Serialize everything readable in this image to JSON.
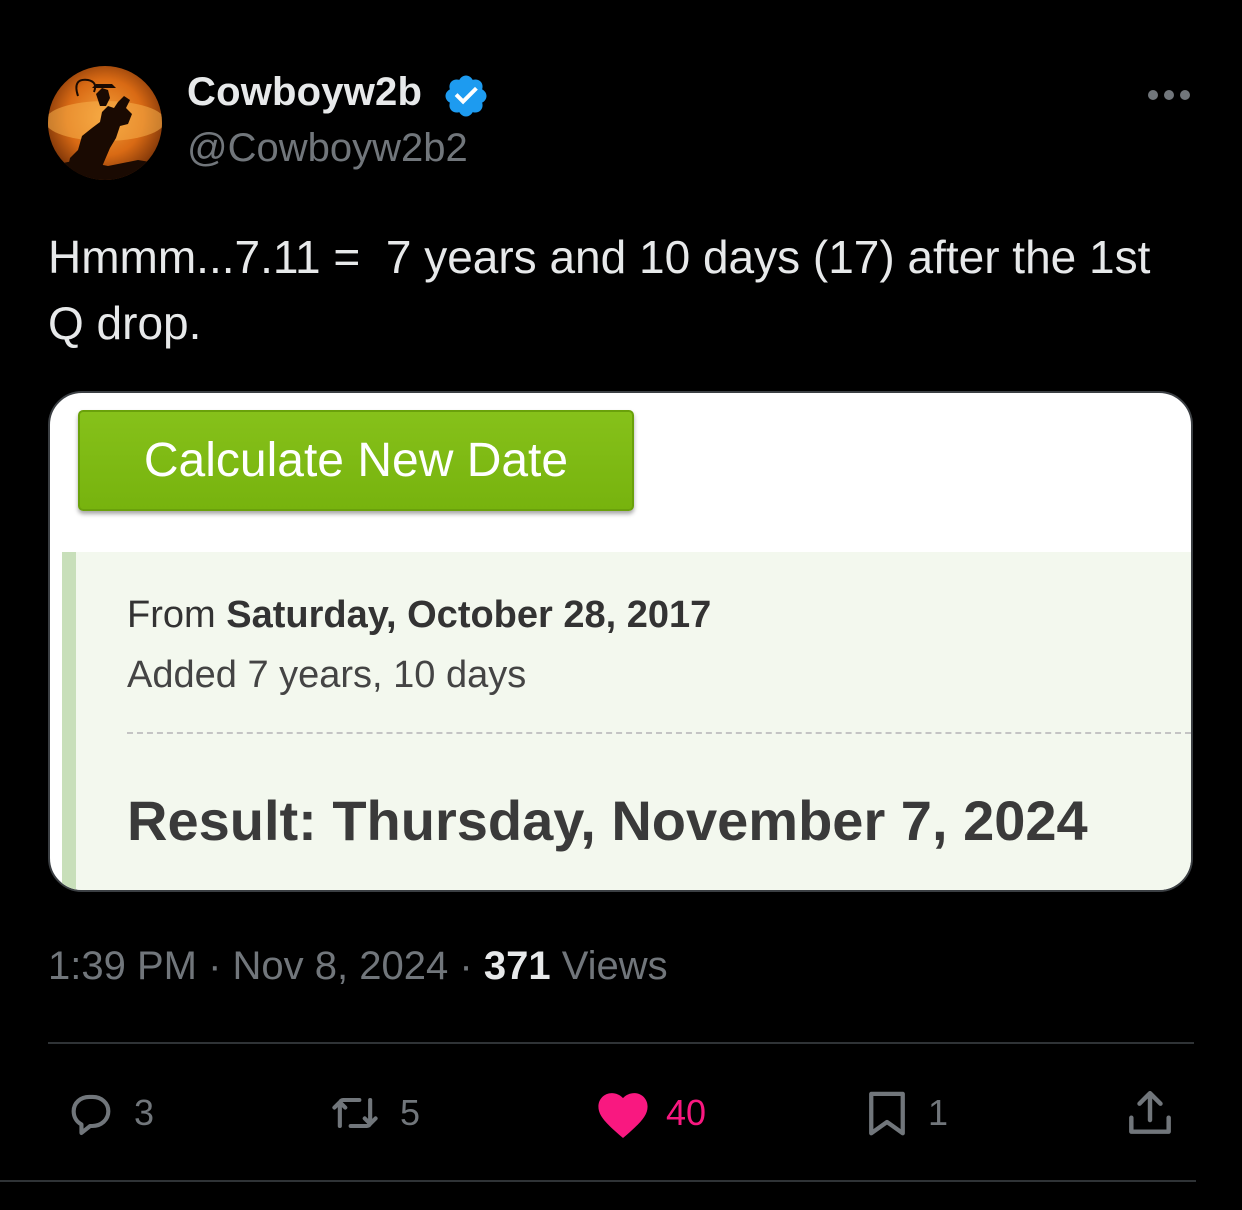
{
  "user": {
    "display_name": "Cowboyw2b",
    "handle": "@Cowboyw2b2",
    "verified": true
  },
  "tweet": {
    "text": "Hmmm...7.11 =  7 years and 10 days (17) after the 1st Q drop."
  },
  "media": {
    "button_label": "Calculate New Date",
    "from_prefix": "From",
    "from_date": "Saturday, October 28, 2017",
    "added_text": "Added 7 years, 10 days",
    "result_text": "Result: Thursday, November 7, 2024"
  },
  "meta": {
    "time": "1:39 PM",
    "separator": "·",
    "date": "Nov 8, 2024",
    "views_count": "371",
    "views_label": "Views"
  },
  "actions": {
    "replies": "3",
    "reposts": "5",
    "likes": "40",
    "bookmarks": "1"
  },
  "colors": {
    "background": "#000000",
    "verified_blue": "#1d9bf0",
    "like_pink": "#f91880",
    "button_green": "#7ab80f",
    "muted_text": "#71767b"
  },
  "icons": [
    "verified-badge-icon",
    "more-icon",
    "reply-icon",
    "repost-icon",
    "heart-icon",
    "bookmark-icon",
    "share-icon"
  ]
}
